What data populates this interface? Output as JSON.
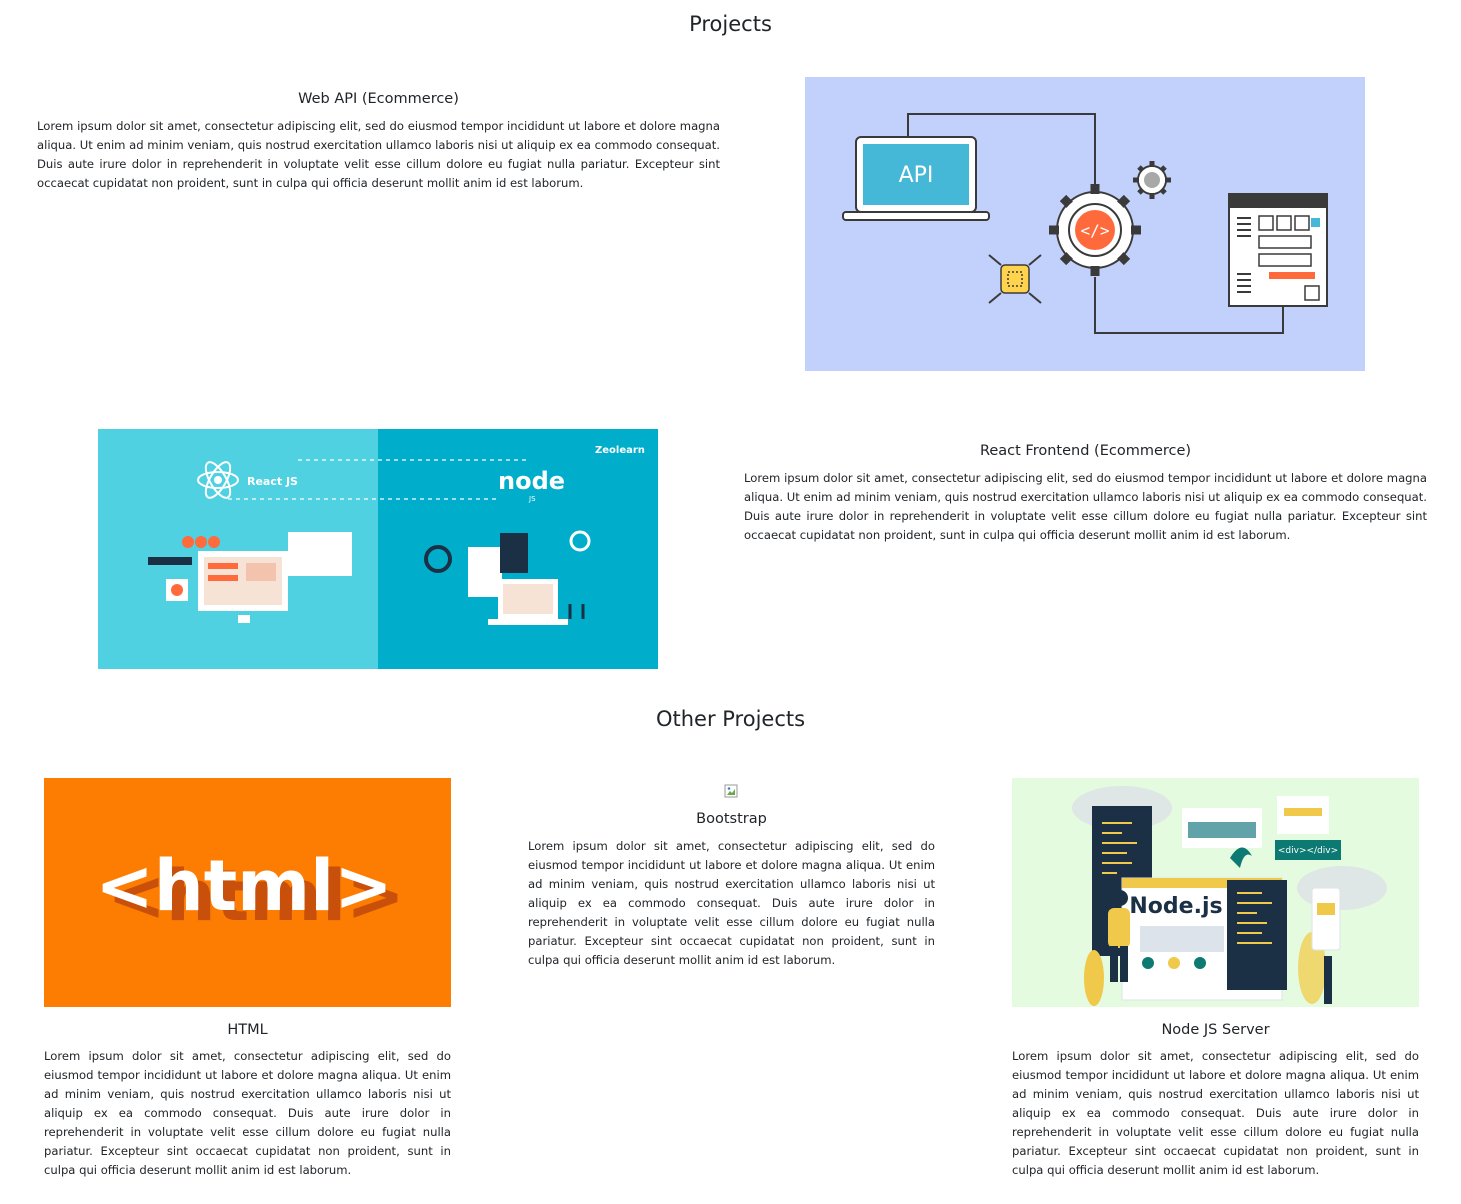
{
  "sections": {
    "projects_title": "Projects",
    "other_title": "Other Projects"
  },
  "lorem": "Lorem ipsum dolor sit amet, consectetur adipiscing elit, sed do eiusmod tempor incididunt ut labore et dolore magna aliqua. Ut enim ad minim veniam, quis nostrud exercitation ullamco laboris nisi ut aliquip ex ea commodo consequat. Duis aute irure dolor in reprehenderit in voluptate velit esse cillum dolore eu fugiat nulla pariatur. Excepteur sint occaecat cupidatat non proident, sunt in culpa qui officia deserunt mollit anim id est laborum.",
  "projects": [
    {
      "title": "Web API (Ecommerce)",
      "image_icon": "api-gear-illustration",
      "image_text": "API"
    },
    {
      "title": "React Frontend (Ecommerce)",
      "image_icon": "react-node-illustration",
      "image_labels": [
        "React JS",
        "node",
        "JS",
        "Zeolearn"
      ]
    }
  ],
  "other_projects": [
    {
      "title": "HTML",
      "image_icon": "html-logo",
      "image_text": "<html>"
    },
    {
      "title": "Bootstrap",
      "image_icon": "broken-image-icon"
    },
    {
      "title": "Node JS Server",
      "image_icon": "nodejs-illustration",
      "image_labels": [
        "Node.js",
        "<div></div>"
      ]
    }
  ],
  "colors": {
    "api_bg": "#c1d1fb",
    "react_bg_left": "#4fd1e2",
    "react_bg_right": "#00aecb",
    "html_bg": "#fd7d02",
    "node_bg": "#e5fbdf"
  }
}
